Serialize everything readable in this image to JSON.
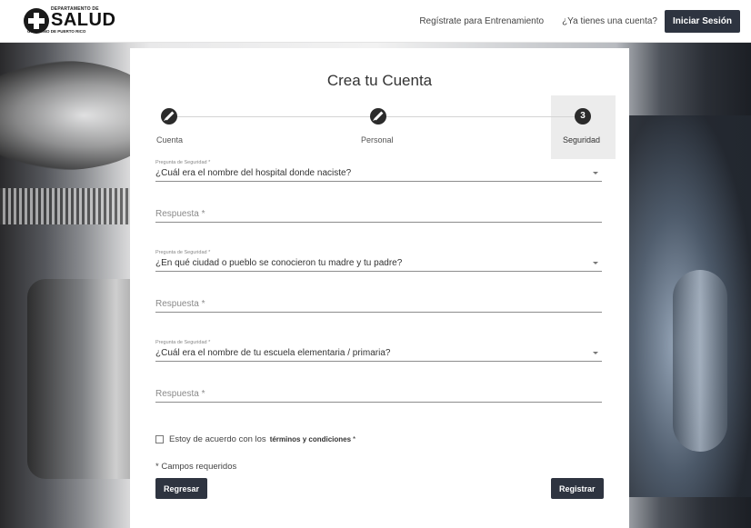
{
  "header": {
    "logo_dept": "DEPARTAMENTO DE",
    "logo_name": "SALUD",
    "logo_gov": "GOBIERNO DE PUERTO RICO",
    "training_link": "Regístrate para Entrenamiento",
    "account_question": "¿Ya tienes una cuenta?",
    "login_button": "Iniciar Sesión"
  },
  "card": {
    "title": "Crea tu Cuenta",
    "steps": [
      {
        "label": "Cuenta",
        "state": "done",
        "icon": "pencil-icon"
      },
      {
        "label": "Personal",
        "state": "done",
        "icon": "pencil-icon"
      },
      {
        "label": "Seguridad",
        "state": "active",
        "number": "3"
      }
    ],
    "questions": [
      {
        "label": "Pregunta de Seguridad *",
        "value": "¿Cuál era el nombre del hospital donde naciste?",
        "answer_placeholder": "Respuesta *"
      },
      {
        "label": "Pregunta de Seguridad *",
        "value": "¿En qué ciudad o pueblo se conocieron tu madre y tu padre?",
        "answer_placeholder": "Respuesta *"
      },
      {
        "label": "Pregunta de Seguridad *",
        "value": "¿Cuál era el nombre de tu escuela elementaria / primaria?",
        "answer_placeholder": "Respuesta *"
      }
    ],
    "terms_text": "Estoy de acuerdo con los",
    "terms_link": "términos y condiciones",
    "terms_required": "*",
    "required_note": "* Campos requeridos",
    "back_button": "Regresar",
    "register_button": "Registrar"
  },
  "colors": {
    "button_bg": "#2e3440",
    "step_circle": "#2b2b2b",
    "active_step_bg": "#ececec"
  }
}
